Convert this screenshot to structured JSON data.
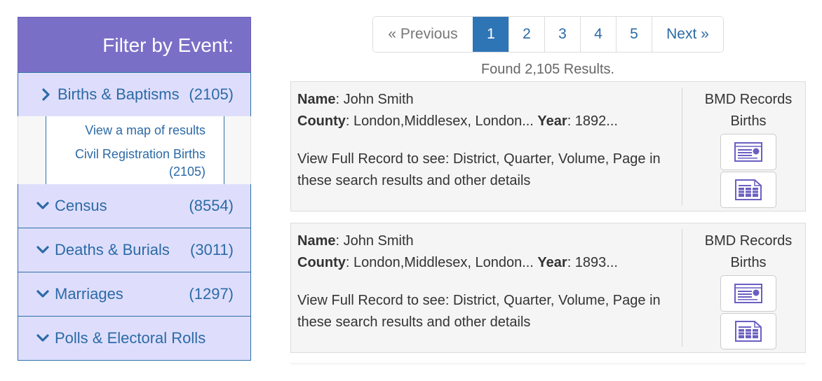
{
  "sidebar": {
    "header": "Filter by Event:",
    "categories": [
      {
        "label": "Births & Baptisms",
        "count": "(2105)",
        "expanded": true
      },
      {
        "label": "Census",
        "count": "(8554)",
        "expanded": false
      },
      {
        "label": "Deaths & Burials",
        "count": "(3011)",
        "expanded": false
      },
      {
        "label": "Marriages",
        "count": "(1297)",
        "expanded": false
      },
      {
        "label": "Polls & Electoral Rolls",
        "count": "",
        "expanded": false
      }
    ],
    "sublinks": {
      "map": "View a map of results",
      "civil": "Civil Registration Births",
      "civil_count": "(2105)"
    }
  },
  "pagination": {
    "prev": "« Previous",
    "pages": [
      "1",
      "2",
      "3",
      "4",
      "5"
    ],
    "active": "1",
    "next": "Next »"
  },
  "found_text": "Found 2,105 Results.",
  "records": [
    {
      "name_label": "Name",
      "name": ": John Smith",
      "county_label": "County",
      "county": ": London,Middlesex, London... ",
      "year_label": "Year",
      "year": ": 1892...",
      "description": "View Full Record to see: District, Quarter, Volume, Page in these search results and other details",
      "source": "BMD Records",
      "type": "Births",
      "icons": [
        "record-card-icon",
        "record-transcript-icon"
      ]
    },
    {
      "name_label": "Name",
      "name": ": John Smith",
      "county_label": "County",
      "county": ": London,Middlesex, London... ",
      "year_label": "Year",
      "year": ": 1893...",
      "description": "View Full Record to see: District, Quarter, Volume, Page in these search results and other details",
      "source": "BMD Records",
      "type": "Births",
      "icons": [
        "record-card-icon",
        "record-transcript-icon"
      ]
    }
  ],
  "colors": {
    "header_bg": "#7a6fc7",
    "category_bg": "#dedefc",
    "link": "#2c6aa6",
    "active_page": "#2e75b6",
    "icon": "#6a5fc2"
  }
}
